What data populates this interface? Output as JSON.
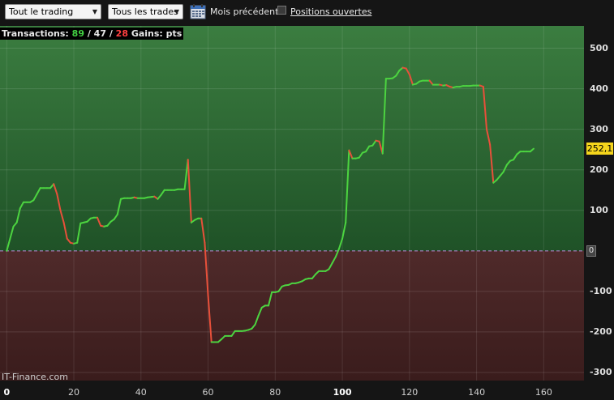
{
  "toolbar": {
    "trading_select": "Tout le trading",
    "trades_select": "Tous les trades",
    "calendar_icon": "calendar-icon",
    "previous_month_label": "Mois précédent",
    "open_positions_label": "Positions ouvertes",
    "open_positions_checked": false
  },
  "stats": {
    "prefix": "Transactions:",
    "total": "89",
    "winning": "47",
    "losing": "28",
    "gains_label": "Gains: pts"
  },
  "watermark": "IT-Finance.com",
  "colors": {
    "profit_zone": "#2f6e35",
    "loss_zone": "#4e2626",
    "rising_line": "#4cd440",
    "falling_line": "#e8503a",
    "zero_line": "#b68dd8",
    "value_badge": "#f5d51c"
  },
  "chart_data": {
    "type": "line",
    "xlim": [
      -2,
      172
    ],
    "ylim": [
      -320,
      555
    ],
    "x_ticks": [
      "0",
      "20",
      "40",
      "60",
      "80",
      "100",
      "120",
      "140",
      "160"
    ],
    "y_ticks": [
      "500",
      "400",
      "300",
      "200",
      "100",
      "0",
      "-100",
      "-200",
      "-300"
    ],
    "last_value": "252,1",
    "zero_label": "0",
    "grid": true,
    "points": [
      [
        0,
        0
      ],
      [
        1,
        30
      ],
      [
        2,
        60
      ],
      [
        3,
        70
      ],
      [
        4,
        105
      ],
      [
        5,
        120
      ],
      [
        6,
        120
      ],
      [
        7,
        120
      ],
      [
        8,
        125
      ],
      [
        9,
        140
      ],
      [
        10,
        155
      ],
      [
        11,
        155
      ],
      [
        12,
        155
      ],
      [
        13,
        155
      ],
      [
        14,
        165
      ],
      [
        15,
        140
      ],
      [
        16,
        100
      ],
      [
        17,
        70
      ],
      [
        18,
        30
      ],
      [
        19,
        20
      ],
      [
        20,
        18
      ],
      [
        21,
        20
      ],
      [
        22,
        68
      ],
      [
        23,
        70
      ],
      [
        24,
        72
      ],
      [
        25,
        80
      ],
      [
        26,
        82
      ],
      [
        27,
        82
      ],
      [
        28,
        62
      ],
      [
        29,
        60
      ],
      [
        30,
        62
      ],
      [
        31,
        72
      ],
      [
        32,
        78
      ],
      [
        33,
        90
      ],
      [
        34,
        128
      ],
      [
        35,
        130
      ],
      [
        36,
        130
      ],
      [
        37,
        130
      ],
      [
        38,
        132
      ],
      [
        39,
        130
      ],
      [
        40,
        130
      ],
      [
        41,
        130
      ],
      [
        42,
        132
      ],
      [
        43,
        133
      ],
      [
        44,
        134
      ],
      [
        45,
        128
      ],
      [
        46,
        138
      ],
      [
        47,
        150
      ],
      [
        48,
        150
      ],
      [
        49,
        150
      ],
      [
        50,
        150
      ],
      [
        51,
        152
      ],
      [
        52,
        152
      ],
      [
        53,
        152
      ],
      [
        54,
        225
      ],
      [
        55,
        70
      ],
      [
        56,
        76
      ],
      [
        57,
        80
      ],
      [
        58,
        80
      ],
      [
        59,
        20
      ],
      [
        60,
        -110
      ],
      [
        61,
        -225
      ],
      [
        62,
        -225
      ],
      [
        63,
        -225
      ],
      [
        64,
        -218
      ],
      [
        65,
        -210
      ],
      [
        66,
        -210
      ],
      [
        67,
        -210
      ],
      [
        68,
        -198
      ],
      [
        69,
        -198
      ],
      [
        70,
        -198
      ],
      [
        71,
        -197
      ],
      [
        72,
        -195
      ],
      [
        73,
        -192
      ],
      [
        74,
        -182
      ],
      [
        75,
        -160
      ],
      [
        76,
        -140
      ],
      [
        77,
        -135
      ],
      [
        78,
        -135
      ],
      [
        79,
        -102
      ],
      [
        80,
        -102
      ],
      [
        81,
        -100
      ],
      [
        82,
        -88
      ],
      [
        83,
        -85
      ],
      [
        84,
        -84
      ],
      [
        85,
        -80
      ],
      [
        86,
        -80
      ],
      [
        87,
        -78
      ],
      [
        88,
        -75
      ],
      [
        89,
        -70
      ],
      [
        90,
        -68
      ],
      [
        91,
        -68
      ],
      [
        92,
        -58
      ],
      [
        93,
        -50
      ],
      [
        94,
        -50
      ],
      [
        95,
        -50
      ],
      [
        96,
        -45
      ],
      [
        97,
        -30
      ],
      [
        98,
        -15
      ],
      [
        99,
        5
      ],
      [
        100,
        30
      ],
      [
        101,
        70
      ],
      [
        102,
        248
      ],
      [
        103,
        228
      ],
      [
        104,
        228
      ],
      [
        105,
        230
      ],
      [
        106,
        242
      ],
      [
        107,
        245
      ],
      [
        108,
        258
      ],
      [
        109,
        260
      ],
      [
        110,
        272
      ],
      [
        111,
        270
      ],
      [
        112,
        240
      ],
      [
        113,
        425
      ],
      [
        114,
        425
      ],
      [
        115,
        426
      ],
      [
        116,
        432
      ],
      [
        117,
        445
      ],
      [
        118,
        452
      ],
      [
        119,
        450
      ],
      [
        120,
        435
      ],
      [
        121,
        410
      ],
      [
        122,
        412
      ],
      [
        123,
        418
      ],
      [
        124,
        420
      ],
      [
        125,
        420
      ],
      [
        126,
        420
      ],
      [
        127,
        410
      ],
      [
        128,
        410
      ],
      [
        129,
        410
      ],
      [
        130,
        408
      ],
      [
        131,
        409
      ],
      [
        132,
        405
      ],
      [
        133,
        403
      ],
      [
        134,
        405
      ],
      [
        135,
        405
      ],
      [
        136,
        407
      ],
      [
        137,
        407
      ],
      [
        138,
        407
      ],
      [
        139,
        408
      ],
      [
        140,
        408
      ],
      [
        141,
        408
      ],
      [
        142,
        405
      ],
      [
        143,
        300
      ],
      [
        144,
        262
      ],
      [
        145,
        168
      ],
      [
        146,
        175
      ],
      [
        147,
        185
      ],
      [
        148,
        195
      ],
      [
        149,
        212
      ],
      [
        150,
        222
      ],
      [
        151,
        225
      ],
      [
        152,
        238
      ],
      [
        153,
        245
      ],
      [
        154,
        245
      ],
      [
        155,
        245
      ],
      [
        156,
        245
      ],
      [
        157,
        252
      ]
    ]
  }
}
